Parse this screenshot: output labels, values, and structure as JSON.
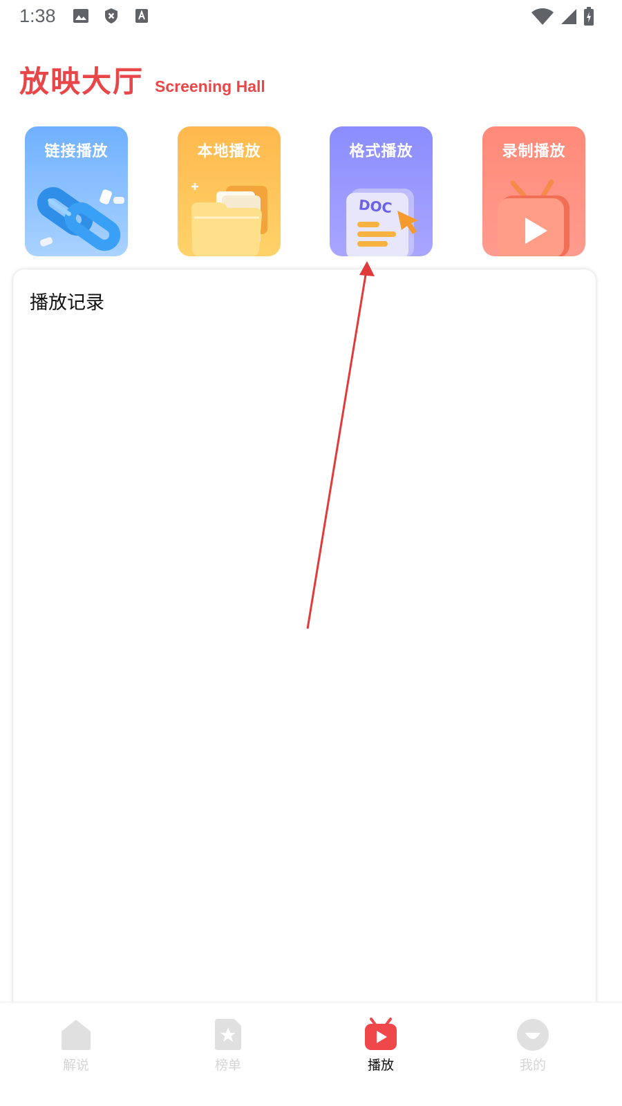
{
  "status_bar": {
    "time": "1:38",
    "left_icons": [
      "image-icon",
      "shield-x-icon",
      "font-a-icon"
    ],
    "right_icons": [
      "wifi-icon",
      "signal-icon",
      "battery-charging-icon"
    ]
  },
  "header": {
    "title_cn": "放映大厅",
    "title_en": "Screening Hall",
    "accent_color": "#e8474a"
  },
  "cards": [
    {
      "label": "链接播放",
      "icon": "chain-link-icon",
      "color": "#6fb0ff"
    },
    {
      "label": "本地播放",
      "icon": "folder-icon",
      "color": "#ffb84d"
    },
    {
      "label": "格式播放",
      "icon": "doc-file-icon",
      "color": "#8b8dff"
    },
    {
      "label": "录制播放",
      "icon": "tv-play-icon",
      "color": "#ff8a78"
    }
  ],
  "history": {
    "title": "播放记录"
  },
  "bottom_nav": {
    "items": [
      {
        "label": "解说",
        "icon": "home-icon",
        "active": false
      },
      {
        "label": "榜单",
        "icon": "star-doc-icon",
        "active": false
      },
      {
        "label": "播放",
        "icon": "tv-play-icon",
        "active": true
      },
      {
        "label": "我的",
        "icon": "face-icon",
        "active": false
      }
    ],
    "active_color": "#f0474a",
    "inactive_color": "#d4d4d4"
  }
}
